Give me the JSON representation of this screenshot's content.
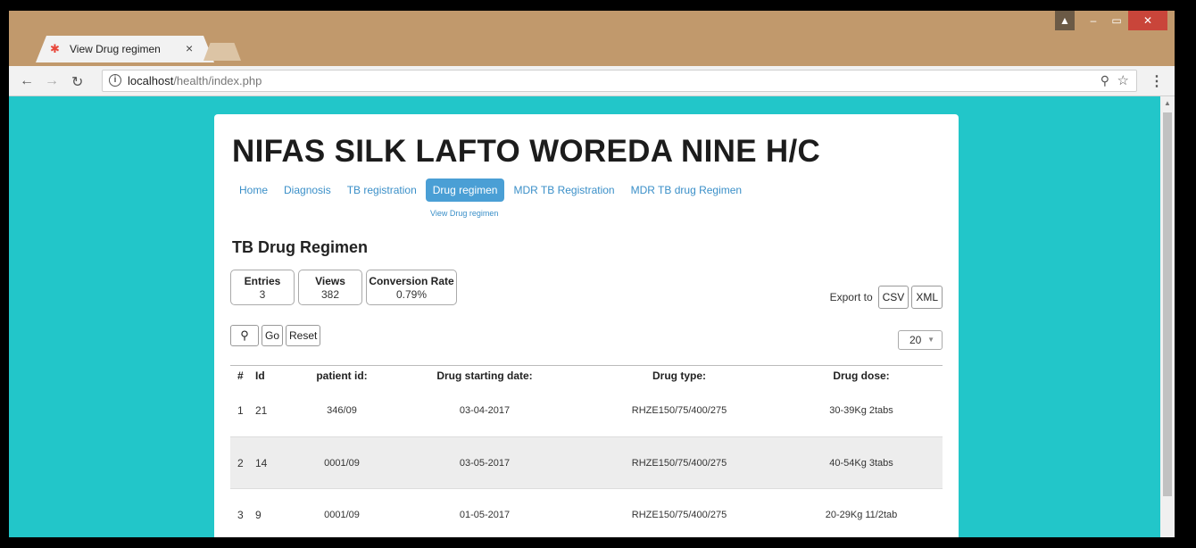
{
  "browser": {
    "tab_title": "View Drug regimen",
    "url_host": "localhost",
    "url_path": "/health/index.php"
  },
  "page": {
    "site_title": "NIFAS SILK LAFTO WOREDA NINE H/C",
    "nav": [
      {
        "label": "Home"
      },
      {
        "label": "Diagnosis"
      },
      {
        "label": "TB registration"
      },
      {
        "label": "Drug regimen"
      },
      {
        "label": "MDR TB Registration"
      },
      {
        "label": "MDR TB drug Regimen"
      }
    ],
    "subnav_label": "View Drug regimen",
    "section_title": "TB Drug Regimen",
    "stats": [
      {
        "label": "Entries",
        "value": "3"
      },
      {
        "label": "Views",
        "value": "382"
      },
      {
        "label": "Conversion Rate",
        "value": "0.79%"
      }
    ],
    "export": {
      "label": "Export to",
      "csv": "CSV",
      "xml": "XML"
    },
    "search": {
      "go": "Go",
      "reset": "Reset"
    },
    "per_page": "20",
    "table": {
      "headers": [
        "#",
        "Id",
        "patient id:",
        "Drug starting date:",
        "Drug type:",
        "Drug dose:"
      ],
      "rows": [
        [
          "1",
          "21",
          "346/09",
          "03-04-2017",
          "RHZE150/75/400/275",
          "30-39Kg 2tabs"
        ],
        [
          "2",
          "14",
          "0001/09",
          "03-05-2017",
          "RHZE150/75/400/275",
          "40-54Kg 3tabs"
        ],
        [
          "3",
          "9",
          "0001/09",
          "01-05-2017",
          "RHZE150/75/400/275",
          "20-29Kg 11/2tab"
        ]
      ]
    }
  },
  "colors": {
    "page_background": "#22c6c9",
    "nav_active": "#4a9fd5",
    "link": "#3a8fc8",
    "browser_frame": "#c1996c"
  }
}
